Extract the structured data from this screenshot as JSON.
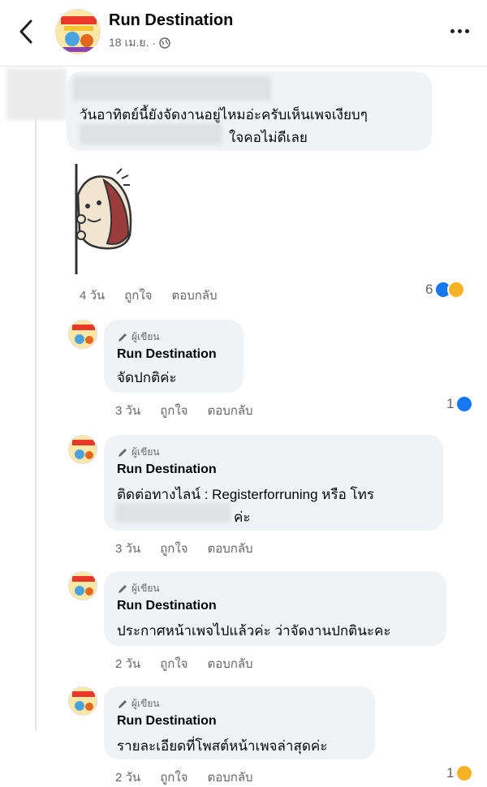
{
  "header": {
    "page_name": "Run Destination",
    "date": "18 เม.ย.",
    "separator": "·"
  },
  "post_comment": {
    "text_line1": "วันอาทิตย์นี้ยังจัดงานอยู่ไหมอ่ะครับเห็นเพจเงียบๆ",
    "text_line2": "ใจคอไม่ดีเลย",
    "time": "4 วัน",
    "like_label": "ถูกใจ",
    "reply_label": "ตอบกลับ",
    "reaction_count": "6"
  },
  "replies": [
    {
      "author_badge": "ผู้เขียน",
      "name": "Run Destination",
      "text_lines": [
        "จัดปกติค่ะ"
      ],
      "time": "3 วัน",
      "like_label": "ถูกใจ",
      "reply_label": "ตอบกลับ",
      "reaction_count": "1"
    },
    {
      "author_badge": "ผู้เขียน",
      "name": "Run Destination",
      "text_lines": [
        "ติดต่อทางไลน์ : Registerforruning หรือ โทร",
        "ค่ะ"
      ],
      "time": "3 วัน",
      "like_label": "ถูกใจ",
      "reply_label": "ตอบกลับ"
    },
    {
      "author_badge": "ผู้เขียน",
      "name": "Run Destination",
      "text_lines": [
        "ประกาศหน้าเพจไปแล้วค่ะ ว่าจัดงานปกตินะคะ"
      ],
      "time": "2 วัน",
      "like_label": "ถูกใจ",
      "reply_label": "ตอบกลับ"
    },
    {
      "author_badge": "ผู้เขียน",
      "name": "Run Destination",
      "text_lines": [
        "รายละเอียดที่โพสต์หน้าเพจล่าสุดค่ะ"
      ],
      "time": "2 วัน",
      "like_label": "ถูกใจ",
      "reply_label": "ตอบกลับ",
      "reaction_count": "1"
    }
  ],
  "colors": {
    "accent_like": "#1877f2",
    "haha": "#f7b125",
    "bubble": "#f0f2f5",
    "muted_text": "#65676b"
  },
  "icons": {
    "back": "chevron-left-icon",
    "globe": "globe-icon",
    "more": "more-horizontal-icon",
    "pencil": "pencil-icon",
    "like": "like-reaction-icon",
    "haha": "haha-reaction-icon"
  }
}
